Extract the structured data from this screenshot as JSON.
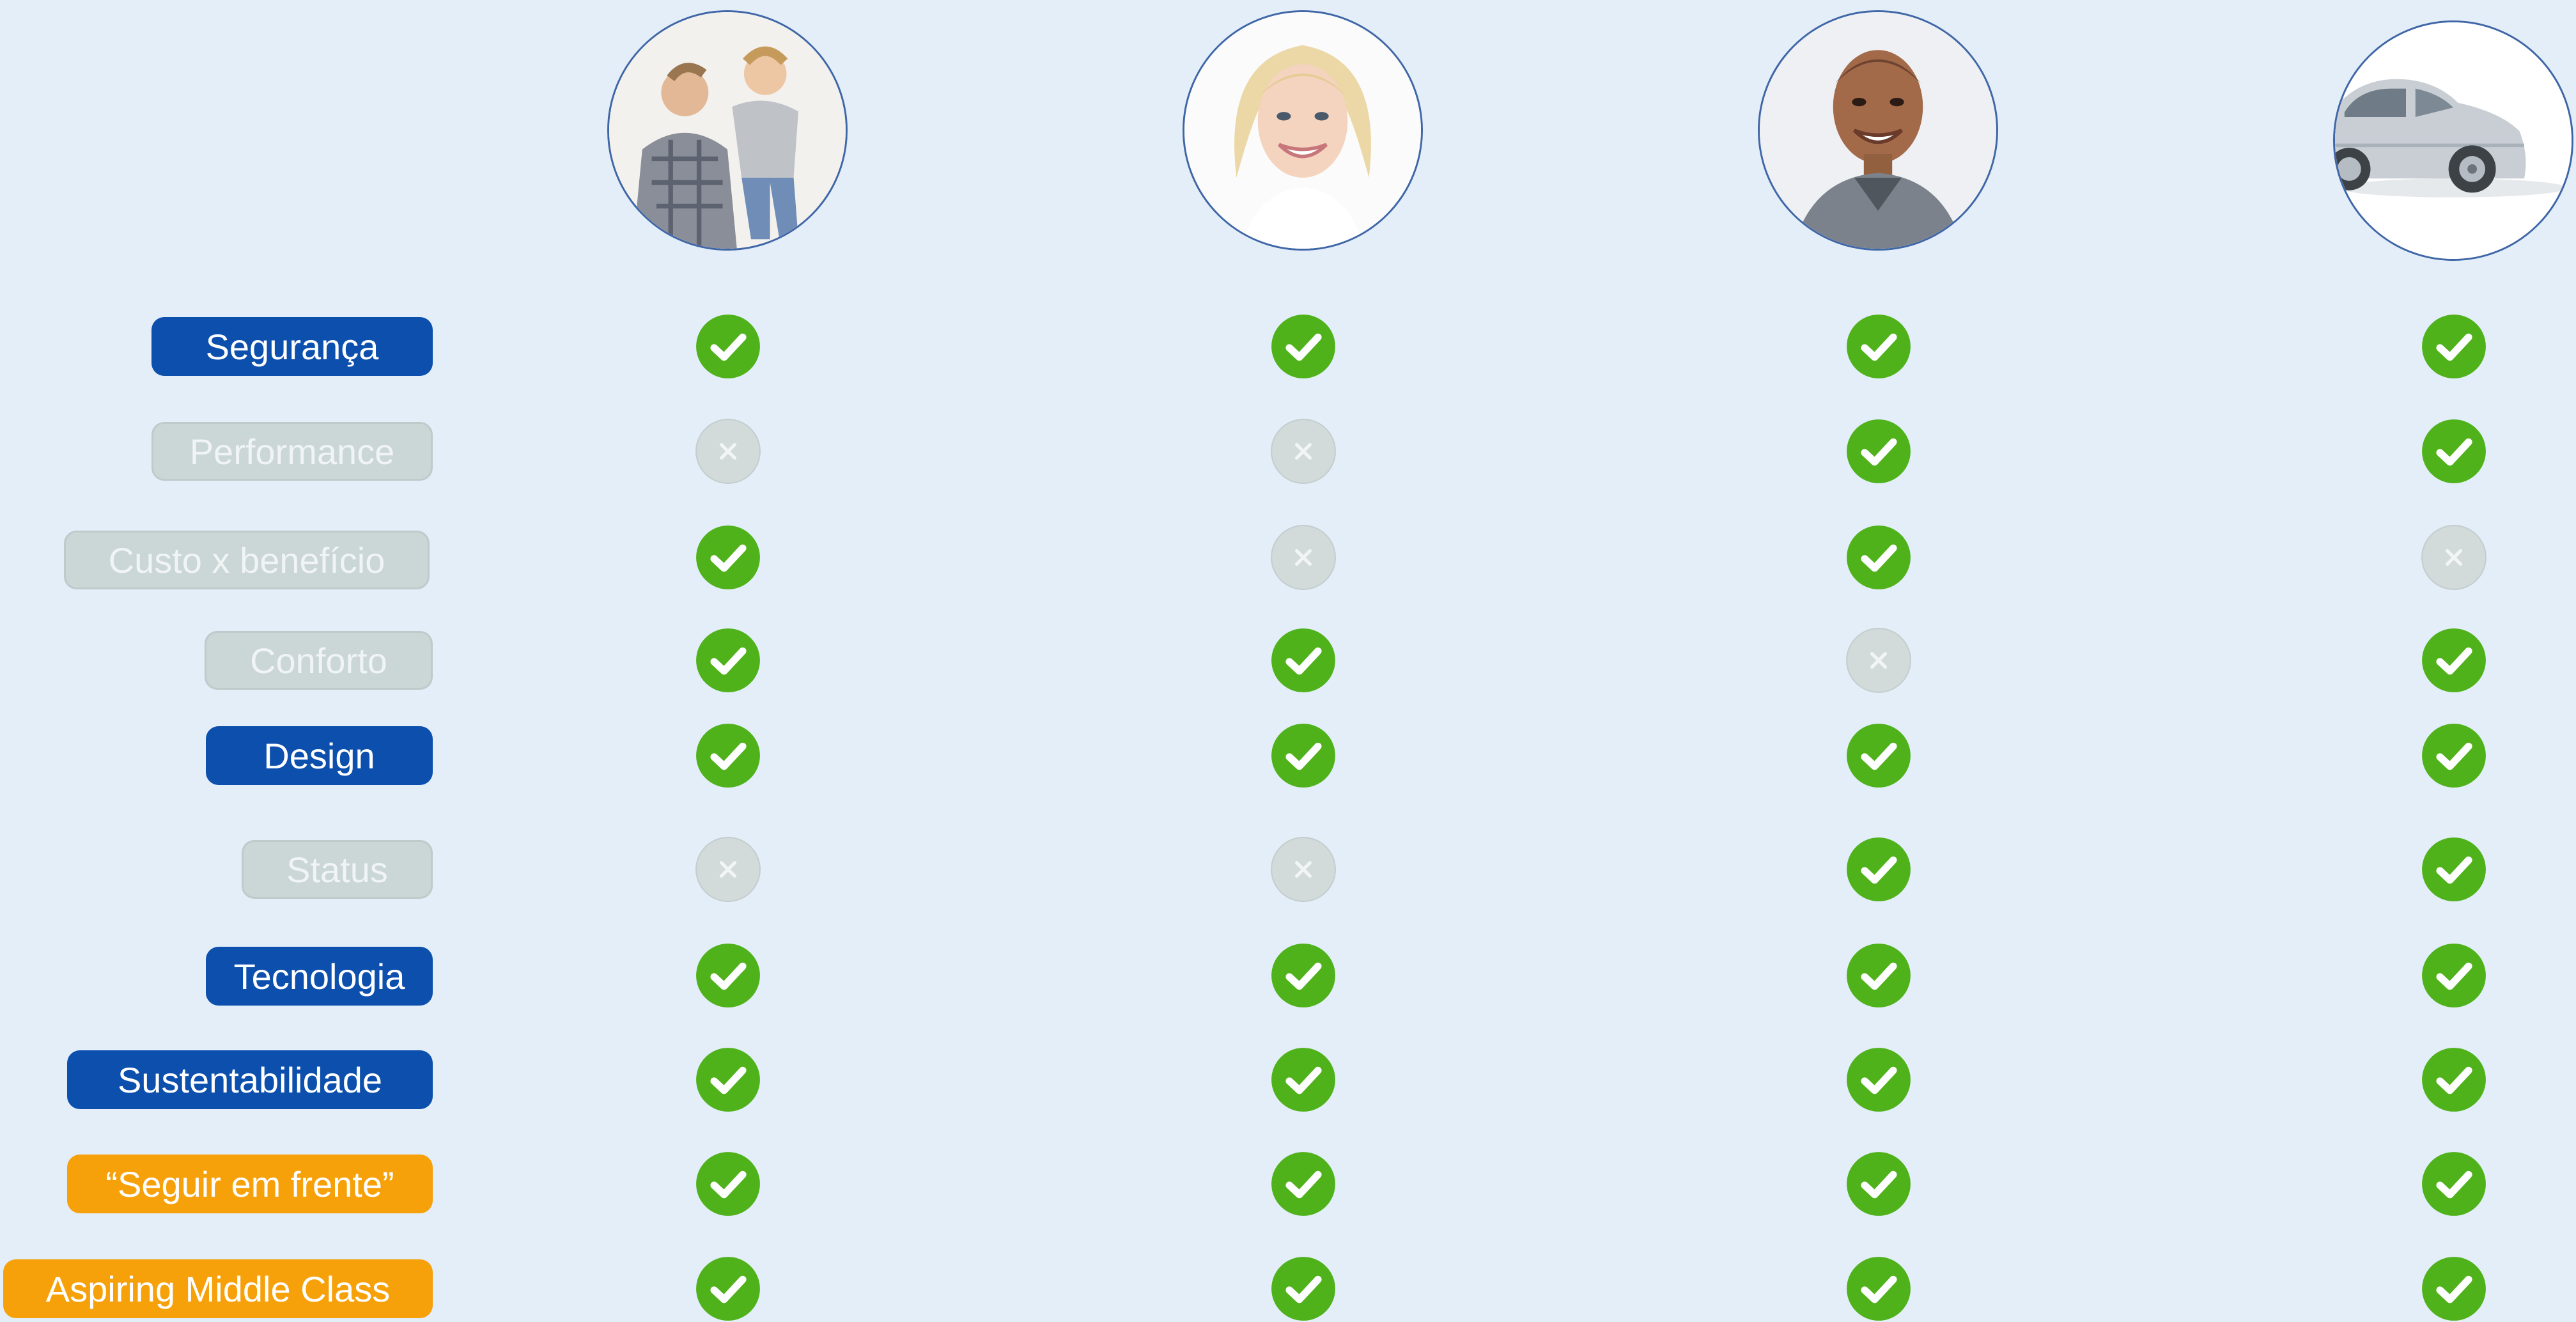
{
  "colors": {
    "background": "#e3eef9",
    "active_pill": "#0c4fad",
    "inactive_pill": "#cbd6d6",
    "highlight_pill": "#f6a10a",
    "check": "#4fb21a",
    "cross": "#d2dada"
  },
  "columns": [
    {
      "icon": "father-and-child-photo"
    },
    {
      "icon": "smiling-woman-photo"
    },
    {
      "icon": "smiling-man-photo"
    },
    {
      "icon": "silver-car-photo"
    }
  ],
  "rows": [
    {
      "label": "Segurança",
      "style": "active",
      "marks": [
        "check",
        "check",
        "check",
        "check"
      ]
    },
    {
      "label": "Performance",
      "style": "inactive",
      "marks": [
        "cross",
        "cross",
        "check",
        "check"
      ]
    },
    {
      "label": "Custo x benefício",
      "style": "inactive",
      "marks": [
        "check",
        "cross",
        "check",
        "cross"
      ]
    },
    {
      "label": "Conforto",
      "style": "inactive",
      "marks": [
        "check",
        "check",
        "cross",
        "check"
      ]
    },
    {
      "label": "Design",
      "style": "active",
      "marks": [
        "check",
        "check",
        "check",
        "check"
      ]
    },
    {
      "label": "Status",
      "style": "inactive",
      "marks": [
        "cross",
        "cross",
        "check",
        "check"
      ]
    },
    {
      "label": "Tecnologia",
      "style": "active",
      "marks": [
        "check",
        "check",
        "check",
        "check"
      ]
    },
    {
      "label": "Sustentabilidade",
      "style": "active",
      "marks": [
        "check",
        "check",
        "check",
        "check"
      ]
    },
    {
      "label": "“Seguir em frente”",
      "style": "highlight",
      "marks": [
        "check",
        "check",
        "check",
        "check"
      ]
    },
    {
      "label": "Aspiring Middle Class",
      "style": "highlight",
      "marks": [
        "check",
        "check",
        "check",
        "check"
      ]
    }
  ]
}
